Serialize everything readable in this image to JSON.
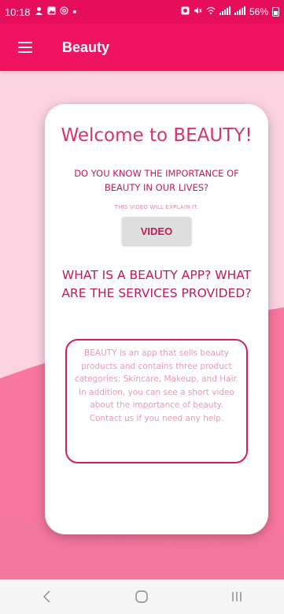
{
  "status_bar": {
    "time": "10:18",
    "left_icons": [
      "person-icon",
      "image-icon",
      "at-icon",
      "dot-icon"
    ],
    "right_icons": [
      "alarm-icon",
      "mute-icon",
      "wifi-icon",
      "signal-icon",
      "signal-icon"
    ],
    "battery": "56%"
  },
  "app_bar": {
    "title": "Beauty",
    "menu_icon": "hamburger-menu-icon"
  },
  "card": {
    "welcome": "Welcome to BEAUTY!",
    "question": "DO YOU KNOW THE IMPORTANCE OF BEAUTY IN OUR LIVES?",
    "hint": "THIS VIDEO WILL EXPLAIN IT.",
    "video_button": "VIDEO",
    "section_title": "WHAT IS A BEAUTY APP? WHAT ARE THE SERVICES PROVIDED?",
    "description": "BEAUTY is an app that sells beauty products and contains three product categories: Skincare, Makeup, and Hair. In addition, you can see a short video about the importance of beauty.",
    "contact": "Contact us if you need any help."
  },
  "nav_bar": {
    "icons": [
      "back-icon",
      "home-icon",
      "recents-icon"
    ]
  },
  "colors": {
    "status_bar": "#e60d5b",
    "app_bar": "#f0135f",
    "background_light": "#fbd3e1",
    "background_wave": "#f7779f",
    "accent_text": "#c2185b",
    "card": "#ffffff"
  }
}
